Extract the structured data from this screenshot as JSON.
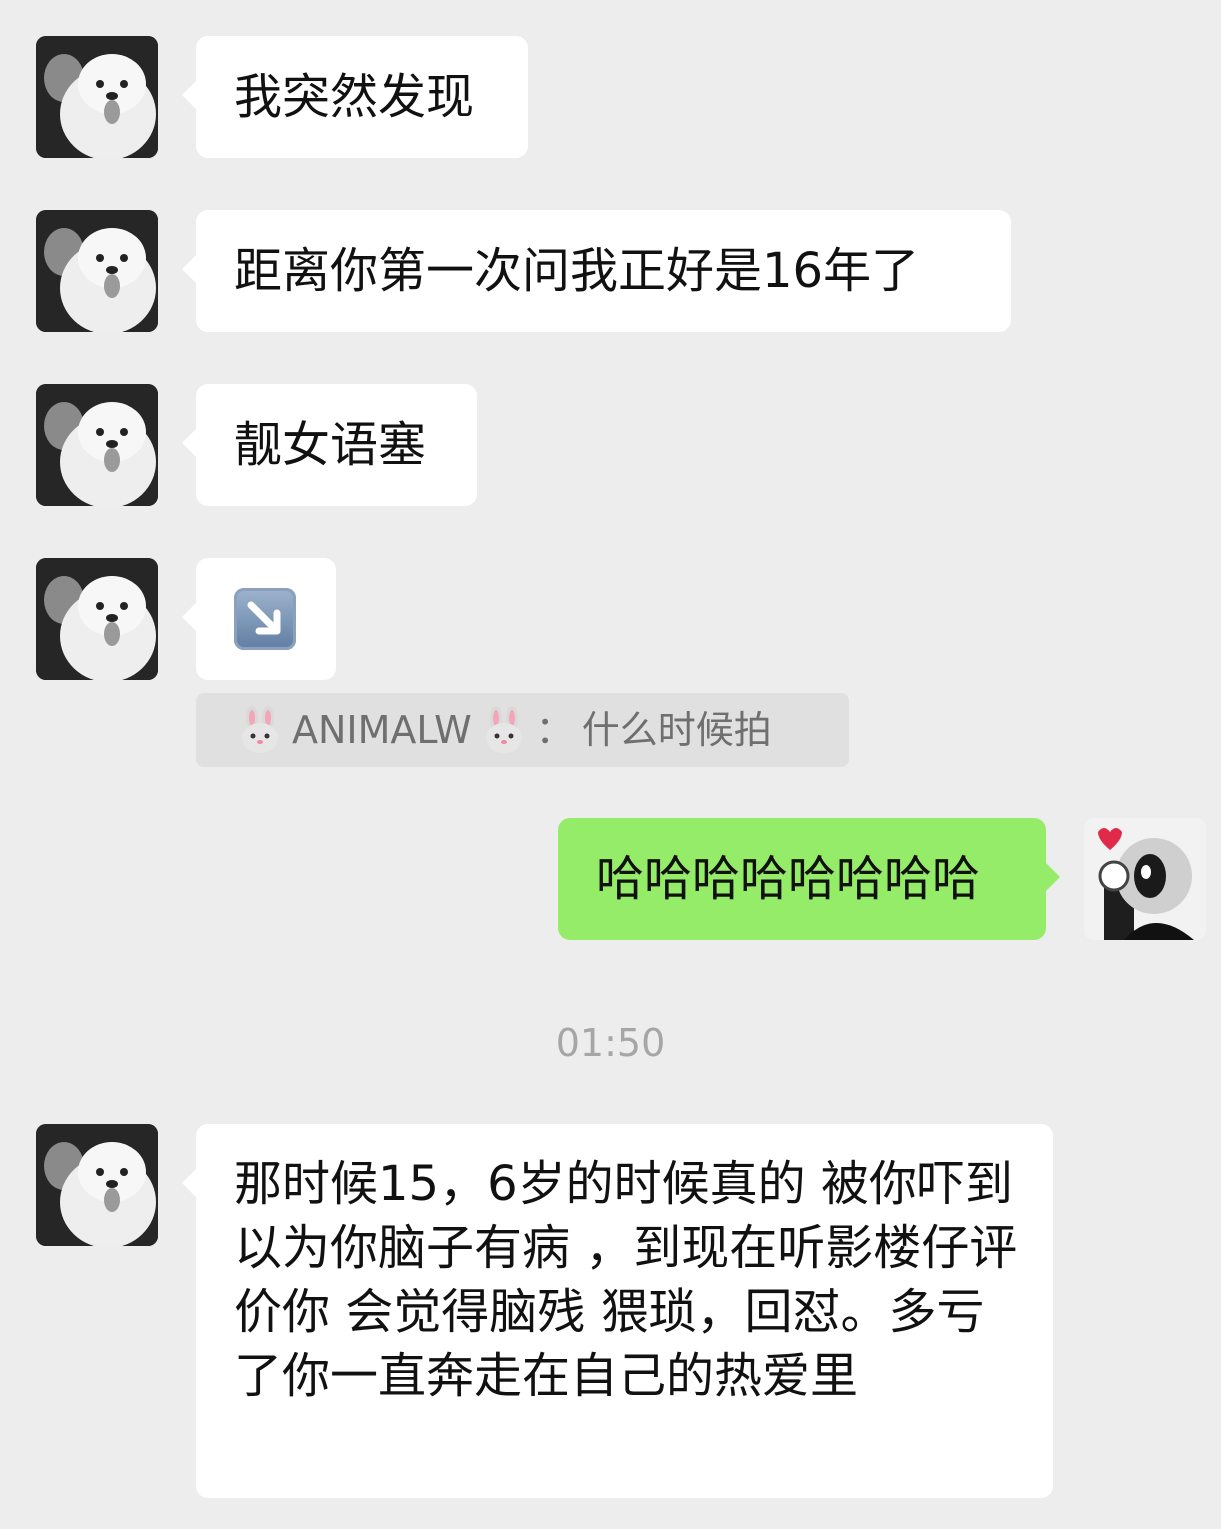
{
  "chat": {
    "messages": [
      {
        "sender": "other",
        "text": "我突然发现"
      },
      {
        "sender": "other",
        "text": "距离你第一次问我正好是16年了"
      },
      {
        "sender": "other",
        "text": "靓女语塞"
      },
      {
        "sender": "other",
        "emoji": "arrow-down-right-icon"
      },
      {
        "sender": "me",
        "text": "哈哈哈哈哈哈哈哈"
      },
      {
        "sender": "other",
        "text": "那时候15，6岁的时候真的 被你吓到 以为你脑子有病 ，到现在听影楼仔评价你 会觉得脑残 猥琐，回怼。多亏了你一直奔走在自己的热爱里"
      }
    ],
    "quote": {
      "name": "ANIMALW",
      "separator": "：",
      "text": "什么时候拍",
      "icon": "rabbit-face-icon"
    },
    "timestamp": "01:50"
  },
  "colors": {
    "background": "#ededed",
    "bubble_other": "#ffffff",
    "bubble_me": "#95ec69",
    "quote_bg": "#e0e0e0",
    "timestamp": "#a6a6a6"
  }
}
